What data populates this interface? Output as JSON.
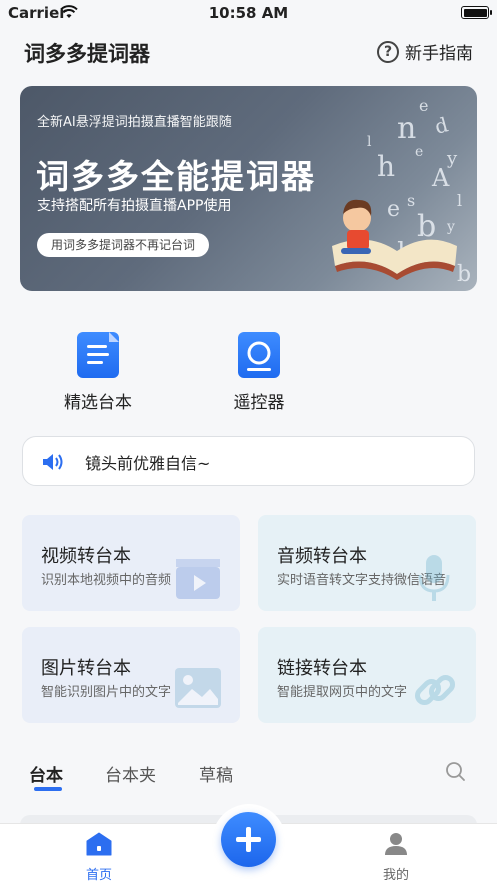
{
  "status_bar": {
    "carrier": "Carrier",
    "time": "10:58 AM"
  },
  "header": {
    "title": "词多多提词器",
    "guide_label": "新手指南"
  },
  "banner": {
    "subtitle": "全新AI悬浮提词拍摄直播智能跟随",
    "title": "词多多全能提词器",
    "description": "支持搭配所有拍摄直播APP使用",
    "pill": "用词多多提词器不再记台词"
  },
  "shortcuts": [
    {
      "label": "精选台本",
      "icon": "document-icon"
    },
    {
      "label": "遥控器",
      "icon": "remote-icon"
    }
  ],
  "notice": {
    "text": "镜头前优雅自信~",
    "icon": "speaker-icon"
  },
  "cards": [
    {
      "title": "视频转台本",
      "subtitle": "识别本地视频中的音频",
      "icon": "video-icon"
    },
    {
      "title": "音频转台本",
      "subtitle": "实时语音转文字支持微信语音",
      "icon": "microphone-icon"
    },
    {
      "title": "图片转台本",
      "subtitle": "智能识别图片中的文字",
      "icon": "image-icon"
    },
    {
      "title": "链接转台本",
      "subtitle": "智能提取网页中的文字",
      "icon": "link-icon"
    }
  ],
  "content_tabs": [
    {
      "label": "台本",
      "active": true
    },
    {
      "label": "台本夹",
      "active": false
    },
    {
      "label": "草稿",
      "active": false
    }
  ],
  "tab_bar": {
    "items": [
      {
        "label": "首页",
        "icon": "home-icon",
        "active": true
      },
      {
        "label": "我的",
        "icon": "profile-icon",
        "active": false
      }
    ]
  },
  "colors": {
    "accent": "#2c6ef0",
    "card_blue": "#e9eef8",
    "card_teal": "#e6f1f6"
  }
}
